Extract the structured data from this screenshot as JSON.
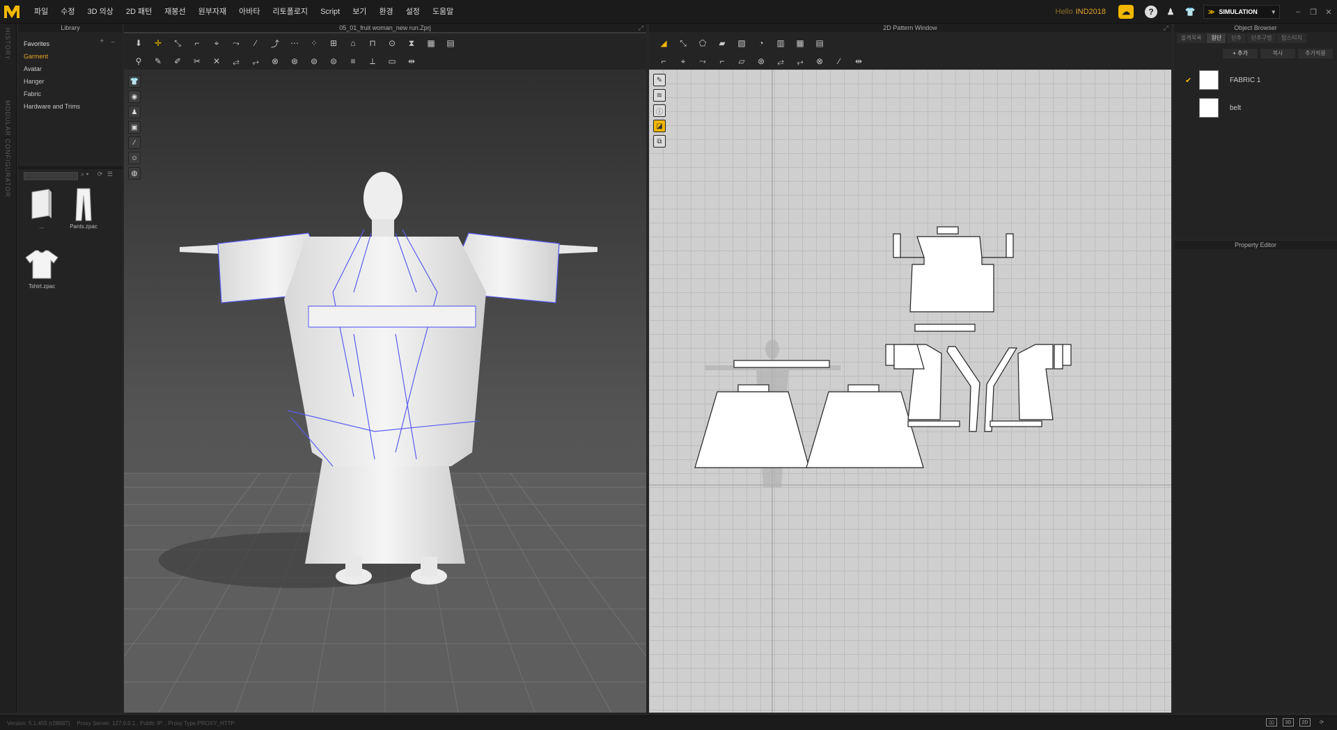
{
  "menu": [
    "파일",
    "수정",
    "3D 의상",
    "2D 패턴",
    "재봉선",
    "원부자재",
    "아바타",
    "리토폴로지",
    "Script",
    "보기",
    "환경",
    "설정",
    "도움말"
  ],
  "user": {
    "hello": "Hello",
    "name": "IND2018"
  },
  "mode": {
    "label": "SIMULATION"
  },
  "history_strip": {
    "history": "HISTORY",
    "modular": "MODULAR CONFIGURATOR"
  },
  "library": {
    "title": "Library",
    "items": [
      "Favorites",
      "Garment",
      "Avatar",
      "Hanger",
      "Fabric",
      "Hardware and Trims"
    ],
    "active": "Garment",
    "thumbnails": [
      {
        "name": "..."
      },
      {
        "name": "Pants.zpac"
      },
      {
        "name": "Tshirt.zpac"
      }
    ]
  },
  "view3d": {
    "title": "05_01_fruit woman_new run.Zprj"
  },
  "view2d": {
    "title": "2D Pattern Window"
  },
  "object_browser": {
    "title": "Object Browser",
    "tabs": [
      "올게목록",
      "원단",
      "단추",
      "단추구멍",
      "탑스티치"
    ],
    "active_tab": "원단",
    "actions": [
      "+ 추가",
      "복사",
      "추가적용"
    ],
    "fabrics": [
      {
        "name": "FABRIC 1",
        "checked": true
      },
      {
        "name": "belt",
        "checked": false
      }
    ]
  },
  "property_editor": {
    "title": "Property Editor"
  },
  "status": {
    "version": "Version: 5.1.455 (r28687)",
    "proxy": "Proxy Server: 127.0.0.1 , Public IP: , Proxy Type:PROXY_HTTP"
  },
  "colors": {
    "accent": "#f2b700",
    "seam": "#5a5cf0"
  }
}
